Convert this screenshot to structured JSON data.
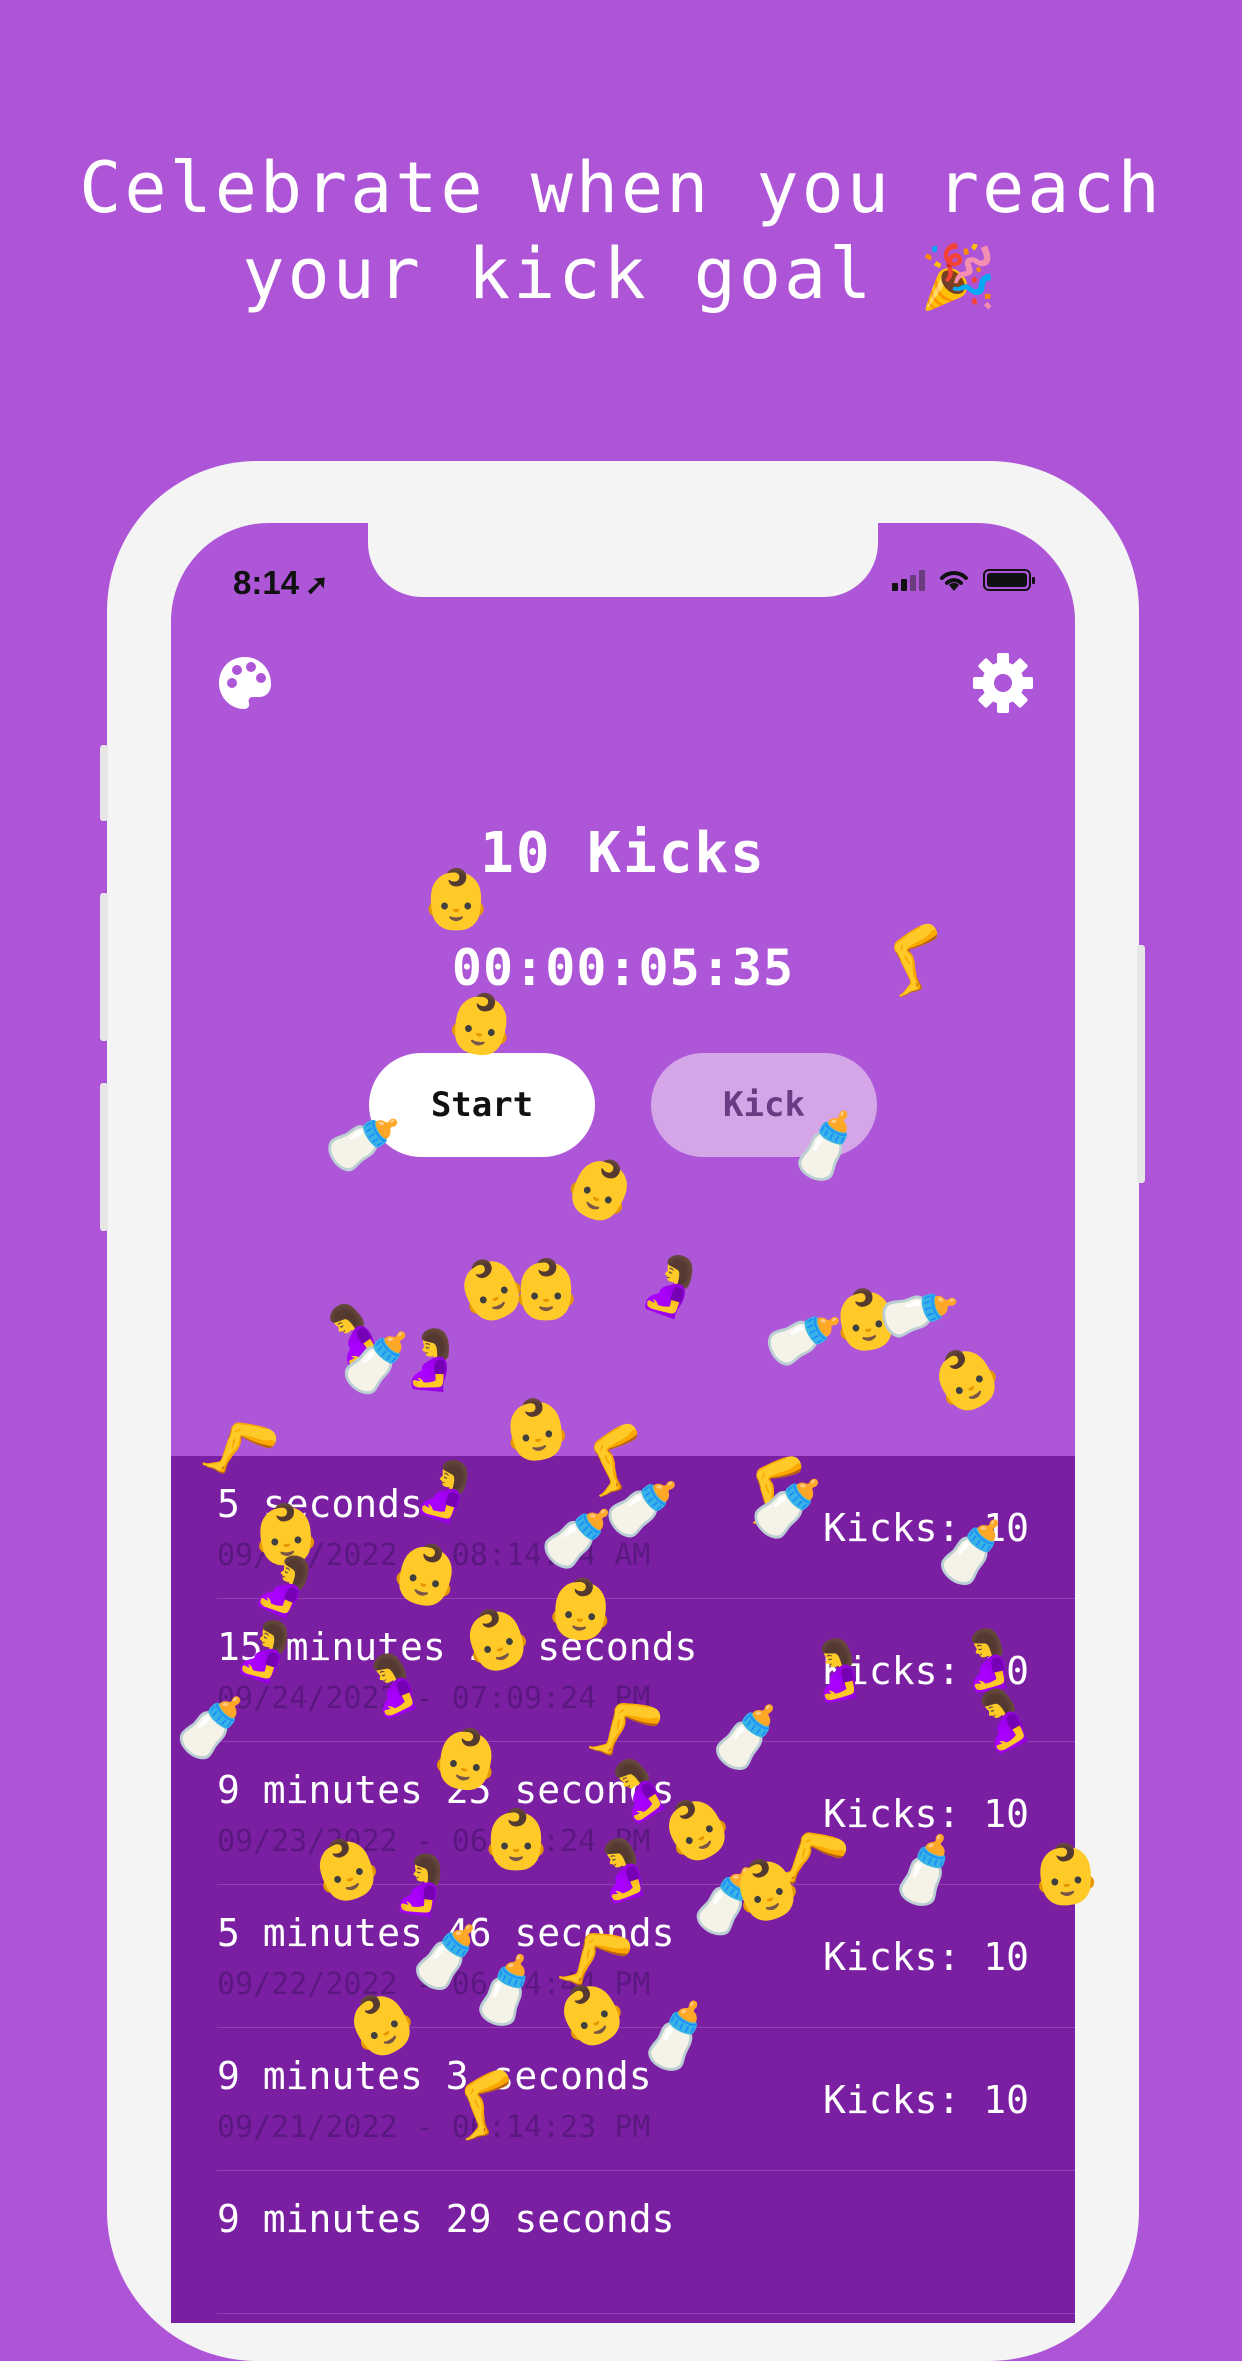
{
  "headline": {
    "line1": "Celebrate when you reach",
    "line2": "your kick goal",
    "emoji": "🎉"
  },
  "status_bar": {
    "time": "8:14",
    "location_icon": "location-arrow-icon",
    "signal_icon": "cellular-signal-icon",
    "wifi_icon": "wifi-icon",
    "battery_icon": "battery-icon"
  },
  "toolbar": {
    "theme_icon": "palette-icon",
    "settings_icon": "gear-icon"
  },
  "counter": {
    "title": "10 Kicks",
    "timer": "00:00:05:35"
  },
  "buttons": {
    "start_label": "Start",
    "kick_label": "Kick"
  },
  "history": [
    {
      "duration": "5 seconds",
      "date": "09/25/2022 - 08:14:04 AM",
      "kicks": "Kicks: 10"
    },
    {
      "duration": "15 minutes 28 seconds",
      "date": "09/24/2022 - 07:09:24 PM",
      "kicks": "Kicks: 10"
    },
    {
      "duration": "9 minutes 25 seconds",
      "date": "09/23/2022 - 06:51:24 PM",
      "kicks": "Kicks: 10"
    },
    {
      "duration": "5 minutes 46 seconds",
      "date": "09/22/2022 - 06:14:44 PM",
      "kicks": "Kicks: 10"
    },
    {
      "duration": "9 minutes 3 seconds",
      "date": "09/21/2022 - 06:14:23 PM",
      "kicks": "Kicks: 10"
    },
    {
      "duration": "9 minutes 29 seconds",
      "date": "",
      "kicks": ""
    }
  ],
  "colors": {
    "background": "#ad55d6",
    "history_panel": "#7b1fa2",
    "kick_button": "#d4a6e8",
    "start_button": "#ffffff"
  },
  "confetti_emojis": [
    "👶",
    "🍼",
    "🤰",
    "🦵"
  ]
}
